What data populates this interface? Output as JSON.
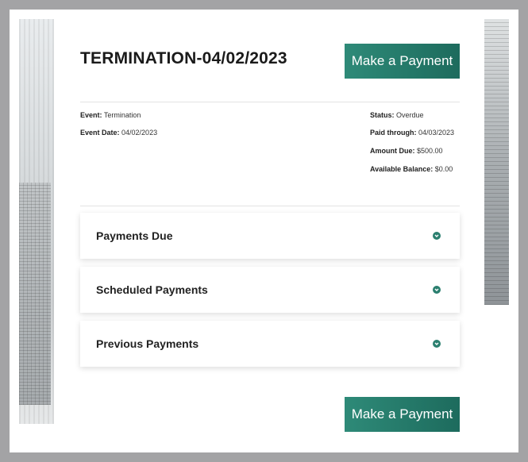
{
  "page": {
    "title": "TERMINATION-04/02/2023"
  },
  "actions": {
    "make_payment_label": "Make a Payment"
  },
  "details": {
    "left": [
      {
        "label": "Event:",
        "value": "Termination"
      },
      {
        "label": "Event Date:",
        "value": "04/02/2023"
      }
    ],
    "right": [
      {
        "label": "Status:",
        "value": "Overdue"
      },
      {
        "label": "Paid through:",
        "value": "04/03/2023"
      },
      {
        "label": "Amount Due:",
        "value": "$500.00"
      },
      {
        "label": "Available Balance:",
        "value": "$0.00"
      }
    ]
  },
  "sections": [
    {
      "label": "Payments Due",
      "icon": "chevron-down-icon"
    },
    {
      "label": "Scheduled Payments",
      "icon": "chevron-down-icon"
    },
    {
      "label": "Previous Payments",
      "icon": "chevron-down-icon"
    }
  ],
  "colors": {
    "accent": "#1d6b5d",
    "frame": "#a3a3a5"
  }
}
